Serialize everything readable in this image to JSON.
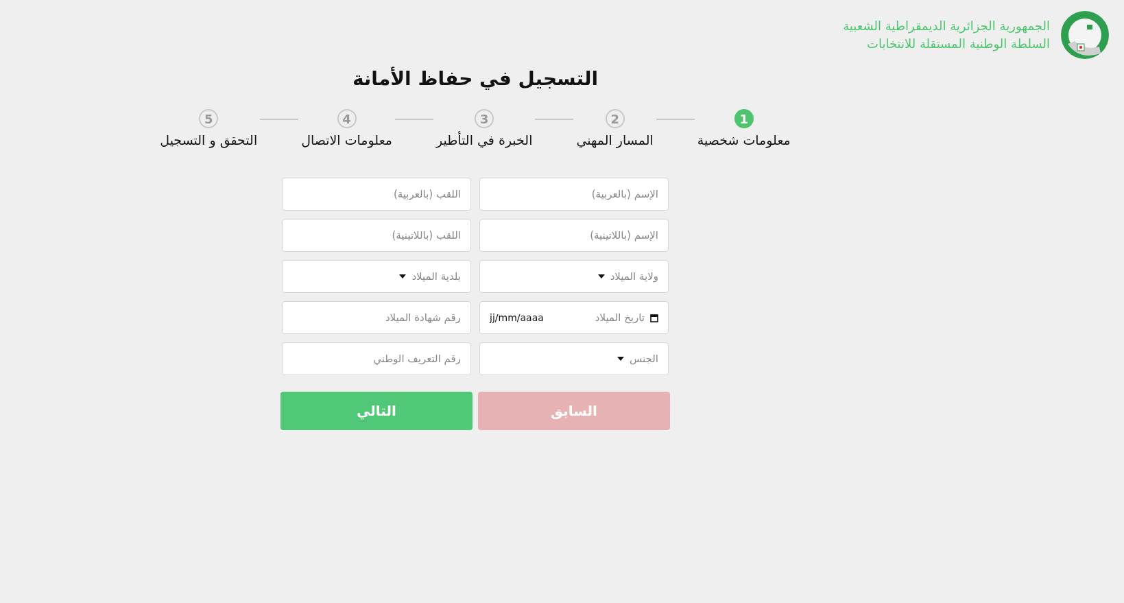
{
  "header": {
    "lines": [
      "الجمهورية الجزائرية الديمقراطية الشعبية",
      "السلطة الوطنية المستقلة للانتخابات"
    ]
  },
  "title": "التسجيل في حفاظ الأمانة",
  "steps": [
    {
      "number": "1",
      "label": "معلومات شخصية",
      "selected": true
    },
    {
      "number": "2",
      "label": "المسار المهني",
      "selected": false
    },
    {
      "number": "3",
      "label": "الخبرة في التأطير",
      "selected": false
    },
    {
      "number": "4",
      "label": "معلومات الاتصال",
      "selected": false
    },
    {
      "number": "5",
      "label": "التحقق و التسجيل",
      "selected": false
    }
  ],
  "fields": [
    {
      "kind": "text",
      "placeholder": "الإسم (بالعربية)"
    },
    {
      "kind": "text",
      "placeholder": "اللقب (بالعربية)"
    },
    {
      "kind": "text",
      "placeholder": "الإسم (باللاتينية)"
    },
    {
      "kind": "text",
      "placeholder": "اللقب (باللاتينية)"
    },
    {
      "kind": "select",
      "placeholder": "ولاية الميلاد"
    },
    {
      "kind": "select",
      "placeholder": "بلدية الميلاد"
    },
    {
      "kind": "date",
      "label": "تاريخ الميلاد",
      "value": "jj/mm/aaaa"
    },
    {
      "kind": "text",
      "placeholder": "رقم شهادة الميلاد"
    },
    {
      "kind": "select",
      "placeholder": "الجنس"
    },
    {
      "kind": "text",
      "placeholder": "رقم التعريف الوطني"
    }
  ],
  "buttons": [
    {
      "kind": "previous",
      "label": "السابق",
      "disabled": true
    },
    {
      "kind": "next",
      "label": "التالي",
      "disabled": false
    }
  ]
}
